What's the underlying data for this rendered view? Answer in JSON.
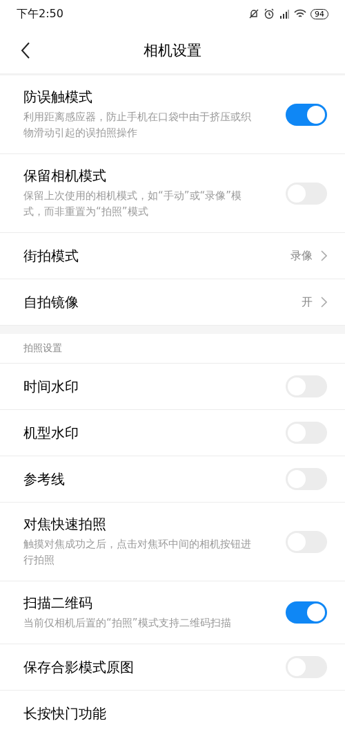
{
  "status_bar": {
    "time": "下午2:50",
    "battery": "94"
  },
  "header": {
    "title": "相机设置"
  },
  "sections": [
    {
      "items": [
        {
          "kind": "toggle",
          "label": "防误触模式",
          "description": "利用距离感应器，防止手机在口袋中由于挤压或织物滑动引起的误拍照操作",
          "on": true
        },
        {
          "kind": "toggle",
          "label": "保留相机模式",
          "description": "保留上次使用的相机模式，如“手动”或“录像”模式，而非重置为“拍照”模式",
          "on": false
        },
        {
          "kind": "link",
          "label": "街拍模式",
          "value": "录像"
        },
        {
          "kind": "link",
          "label": "自拍镜像",
          "value": "开"
        }
      ]
    },
    {
      "title": "拍照设置",
      "items": [
        {
          "kind": "toggle",
          "label": "时间水印",
          "on": false
        },
        {
          "kind": "toggle",
          "label": "机型水印",
          "on": false
        },
        {
          "kind": "toggle",
          "label": "参考线",
          "on": false
        },
        {
          "kind": "toggle",
          "label": "对焦快速拍照",
          "description": "触摸对焦成功之后，点击对焦环中间的相机按钮进行拍照",
          "on": false
        },
        {
          "kind": "toggle",
          "label": "扫描二维码",
          "description": "当前仅相机后置的“拍照”模式支持二维码扫描",
          "on": true
        },
        {
          "kind": "toggle",
          "label": "保存合影模式原图",
          "on": false
        },
        {
          "kind": "plain",
          "label": "长按快门功能"
        }
      ]
    }
  ]
}
